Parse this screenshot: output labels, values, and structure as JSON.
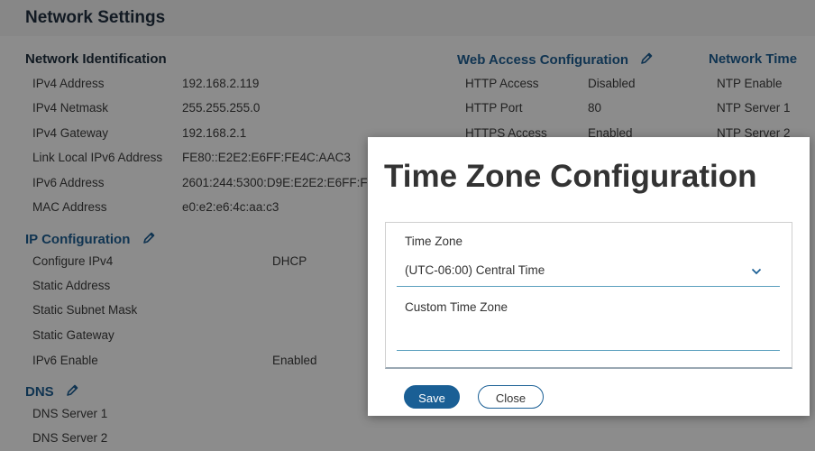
{
  "header": {
    "title": "Network Settings"
  },
  "network_identification": {
    "title": "Network Identification",
    "rows": [
      {
        "label": "IPv4 Address",
        "value": "192.168.2.119"
      },
      {
        "label": "IPv4 Netmask",
        "value": "255.255.255.0"
      },
      {
        "label": "IPv4 Gateway",
        "value": "192.168.2.1"
      },
      {
        "label": "Link Local IPv6 Address",
        "value": "FE80::E2E2:E6FF:FE4C:AAC3"
      },
      {
        "label": "IPv6 Address",
        "value": "2601:244:5300:D9E:E2E2:E6FF:F"
      },
      {
        "label": "MAC Address",
        "value": "e0:e2:e6:4c:aa:c3"
      }
    ]
  },
  "ip_configuration": {
    "title": "IP Configuration",
    "rows": [
      {
        "label": "Configure IPv4",
        "value": "DHCP"
      },
      {
        "label": "Static Address",
        "value": ""
      },
      {
        "label": "Static Subnet Mask",
        "value": ""
      },
      {
        "label": "Static Gateway",
        "value": ""
      },
      {
        "label": "IPv6 Enable",
        "value": "Enabled"
      }
    ]
  },
  "dns": {
    "title": "DNS",
    "rows": [
      {
        "label": "DNS Server 1"
      },
      {
        "label": "DNS Server 2"
      }
    ]
  },
  "web_access": {
    "title": "Web Access Configuration",
    "rows": [
      {
        "label": "HTTP Access",
        "value": "Disabled"
      },
      {
        "label": "HTTP Port",
        "value": "80"
      },
      {
        "label": "HTTPS Access",
        "value": "Enabled"
      }
    ]
  },
  "network_time": {
    "title": "Network Time",
    "rows": [
      {
        "label": "NTP Enable"
      },
      {
        "label": "NTP Server 1"
      },
      {
        "label": "NTP Server 2"
      }
    ]
  },
  "modal": {
    "title": "Time Zone Configuration",
    "time_zone_label": "Time Zone",
    "time_zone_value": "(UTC-06:00) Central Time",
    "custom_label": "Custom Time Zone",
    "custom_value": "",
    "save_label": "Save",
    "close_label": "Close"
  },
  "colors": {
    "accent": "#1a5f95",
    "section_blue": "#1d5a8c",
    "underline": "#5a9fbe"
  },
  "icons": [
    "pencil-icon",
    "chevron-down-icon"
  ]
}
